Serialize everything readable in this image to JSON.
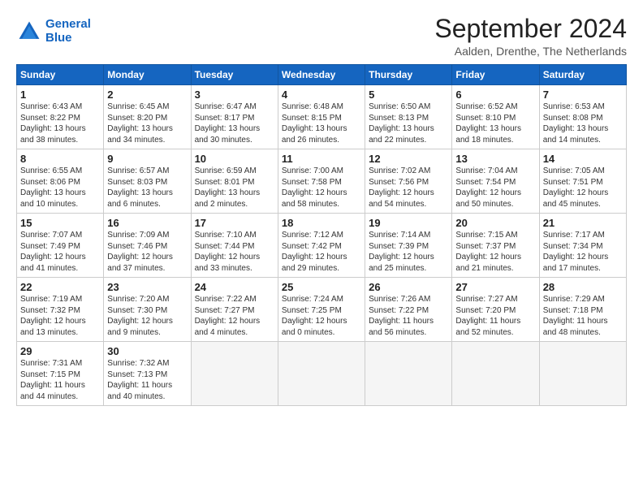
{
  "logo": {
    "line1": "General",
    "line2": "Blue"
  },
  "title": "September 2024",
  "subtitle": "Aalden, Drenthe, The Netherlands",
  "header": {
    "days": [
      "Sunday",
      "Monday",
      "Tuesday",
      "Wednesday",
      "Thursday",
      "Friday",
      "Saturday"
    ]
  },
  "weeks": [
    [
      {
        "day": "1",
        "info": "Sunrise: 6:43 AM\nSunset: 8:22 PM\nDaylight: 13 hours\nand 38 minutes."
      },
      {
        "day": "2",
        "info": "Sunrise: 6:45 AM\nSunset: 8:20 PM\nDaylight: 13 hours\nand 34 minutes."
      },
      {
        "day": "3",
        "info": "Sunrise: 6:47 AM\nSunset: 8:17 PM\nDaylight: 13 hours\nand 30 minutes."
      },
      {
        "day": "4",
        "info": "Sunrise: 6:48 AM\nSunset: 8:15 PM\nDaylight: 13 hours\nand 26 minutes."
      },
      {
        "day": "5",
        "info": "Sunrise: 6:50 AM\nSunset: 8:13 PM\nDaylight: 13 hours\nand 22 minutes."
      },
      {
        "day": "6",
        "info": "Sunrise: 6:52 AM\nSunset: 8:10 PM\nDaylight: 13 hours\nand 18 minutes."
      },
      {
        "day": "7",
        "info": "Sunrise: 6:53 AM\nSunset: 8:08 PM\nDaylight: 13 hours\nand 14 minutes."
      }
    ],
    [
      {
        "day": "8",
        "info": "Sunrise: 6:55 AM\nSunset: 8:06 PM\nDaylight: 13 hours\nand 10 minutes."
      },
      {
        "day": "9",
        "info": "Sunrise: 6:57 AM\nSunset: 8:03 PM\nDaylight: 13 hours\nand 6 minutes."
      },
      {
        "day": "10",
        "info": "Sunrise: 6:59 AM\nSunset: 8:01 PM\nDaylight: 13 hours\nand 2 minutes."
      },
      {
        "day": "11",
        "info": "Sunrise: 7:00 AM\nSunset: 7:58 PM\nDaylight: 12 hours\nand 58 minutes."
      },
      {
        "day": "12",
        "info": "Sunrise: 7:02 AM\nSunset: 7:56 PM\nDaylight: 12 hours\nand 54 minutes."
      },
      {
        "day": "13",
        "info": "Sunrise: 7:04 AM\nSunset: 7:54 PM\nDaylight: 12 hours\nand 50 minutes."
      },
      {
        "day": "14",
        "info": "Sunrise: 7:05 AM\nSunset: 7:51 PM\nDaylight: 12 hours\nand 45 minutes."
      }
    ],
    [
      {
        "day": "15",
        "info": "Sunrise: 7:07 AM\nSunset: 7:49 PM\nDaylight: 12 hours\nand 41 minutes."
      },
      {
        "day": "16",
        "info": "Sunrise: 7:09 AM\nSunset: 7:46 PM\nDaylight: 12 hours\nand 37 minutes."
      },
      {
        "day": "17",
        "info": "Sunrise: 7:10 AM\nSunset: 7:44 PM\nDaylight: 12 hours\nand 33 minutes."
      },
      {
        "day": "18",
        "info": "Sunrise: 7:12 AM\nSunset: 7:42 PM\nDaylight: 12 hours\nand 29 minutes."
      },
      {
        "day": "19",
        "info": "Sunrise: 7:14 AM\nSunset: 7:39 PM\nDaylight: 12 hours\nand 25 minutes."
      },
      {
        "day": "20",
        "info": "Sunrise: 7:15 AM\nSunset: 7:37 PM\nDaylight: 12 hours\nand 21 minutes."
      },
      {
        "day": "21",
        "info": "Sunrise: 7:17 AM\nSunset: 7:34 PM\nDaylight: 12 hours\nand 17 minutes."
      }
    ],
    [
      {
        "day": "22",
        "info": "Sunrise: 7:19 AM\nSunset: 7:32 PM\nDaylight: 12 hours\nand 13 minutes."
      },
      {
        "day": "23",
        "info": "Sunrise: 7:20 AM\nSunset: 7:30 PM\nDaylight: 12 hours\nand 9 minutes."
      },
      {
        "day": "24",
        "info": "Sunrise: 7:22 AM\nSunset: 7:27 PM\nDaylight: 12 hours\nand 4 minutes."
      },
      {
        "day": "25",
        "info": "Sunrise: 7:24 AM\nSunset: 7:25 PM\nDaylight: 12 hours\nand 0 minutes."
      },
      {
        "day": "26",
        "info": "Sunrise: 7:26 AM\nSunset: 7:22 PM\nDaylight: 11 hours\nand 56 minutes."
      },
      {
        "day": "27",
        "info": "Sunrise: 7:27 AM\nSunset: 7:20 PM\nDaylight: 11 hours\nand 52 minutes."
      },
      {
        "day": "28",
        "info": "Sunrise: 7:29 AM\nSunset: 7:18 PM\nDaylight: 11 hours\nand 48 minutes."
      }
    ],
    [
      {
        "day": "29",
        "info": "Sunrise: 7:31 AM\nSunset: 7:15 PM\nDaylight: 11 hours\nand 44 minutes."
      },
      {
        "day": "30",
        "info": "Sunrise: 7:32 AM\nSunset: 7:13 PM\nDaylight: 11 hours\nand 40 minutes."
      },
      {
        "day": "",
        "info": ""
      },
      {
        "day": "",
        "info": ""
      },
      {
        "day": "",
        "info": ""
      },
      {
        "day": "",
        "info": ""
      },
      {
        "day": "",
        "info": ""
      }
    ]
  ]
}
